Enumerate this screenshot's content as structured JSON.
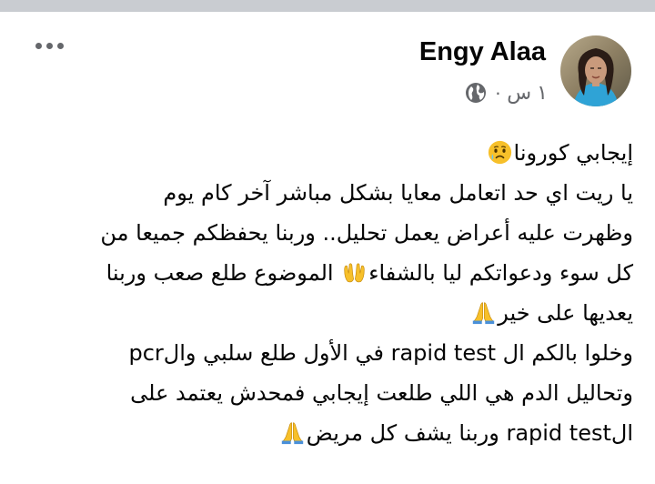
{
  "post": {
    "author": "Engy Alaa",
    "time": "١ س ·",
    "privacy_icon": "globe-icon",
    "more_icon": "more-dots-icon",
    "lines": [
      "إيجابي كورونا",
      "يا ريت اي حد اتعامل معايا بشكل مباشر آخر كام يوم",
      "وظهرت عليه أعراض يعمل تحليل.. وربنا يحفظكم جميعا من",
      "كل سوء ودعواتكم ليا بالشفاء",
      " الموضوع طلع صعب وربنا",
      "يعديها على خير",
      "وخلوا بالكم ال rapid test في الأول طلع سلبي والpcr",
      "وتحاليل الدم هي اللي طلعت إيجابي فمحدش يعتمد على",
      "الrapid test وربنا يشف كل مريض"
    ],
    "emojis": {
      "sad_face": "sad-sweat-face-emoji",
      "open_hands": "open-hands-emoji",
      "folded_hands": "folded-hands-emoji"
    }
  },
  "colors": {
    "text": "#050505",
    "secondary_text": "#65676b",
    "divider": "#c9ccd1",
    "emoji_yellow": "#f7c02a"
  }
}
